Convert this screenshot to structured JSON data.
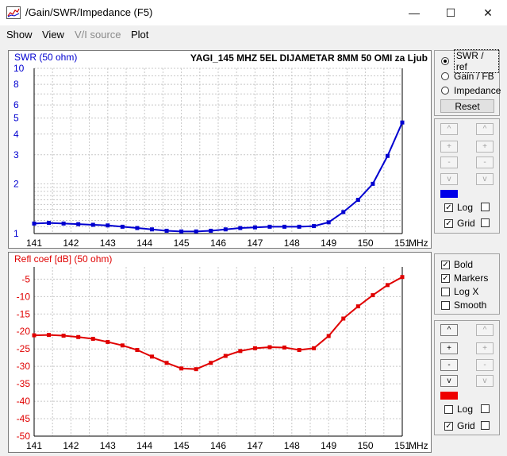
{
  "window": {
    "title": "/Gain/SWR/Impedance (F5)",
    "minimize": "—",
    "maximize": "☐",
    "close": "✕"
  },
  "menu": [
    {
      "label": "Show",
      "enabled": true
    },
    {
      "label": "View",
      "enabled": true
    },
    {
      "label": "V/I source",
      "enabled": false
    },
    {
      "label": "Plot",
      "enabled": true
    }
  ],
  "top_graph": {
    "title": "YAGI_145 MHZ 5EL DIJAMETAR 8MM 50 OMI za Ljub",
    "ylabel": "SWR (50 ohm)",
    "y_ticks": [
      {
        "v": 1,
        "label": "1"
      },
      {
        "v": 2,
        "label": "2"
      },
      {
        "v": 3,
        "label": "3"
      },
      {
        "v": 4,
        "label": "4"
      },
      {
        "v": 5,
        "label": "5"
      },
      {
        "v": 6,
        "label": "6"
      },
      {
        "v": 8,
        "label": "8"
      },
      {
        "v": 10,
        "label": "10"
      }
    ],
    "color": "#0000d0"
  },
  "bottom_graph": {
    "ylabel": "Refl coef [dB] (50 ohm)",
    "y_ticks": [
      "-5",
      "-10",
      "-15",
      "-20",
      "-25",
      "-30",
      "-35",
      "-40",
      "-45",
      "-50"
    ],
    "color": "#e00000"
  },
  "x_axis": {
    "ticks": [
      "141",
      "142",
      "143",
      "144",
      "145",
      "146",
      "147",
      "148",
      "149",
      "150",
      "151"
    ],
    "unit": "MHz"
  },
  "chart_data": [
    {
      "type": "line",
      "ylabel": "SWR (50 ohm)",
      "xlabel": "MHz",
      "ylim": [
        1,
        10
      ],
      "xlim": [
        141,
        151
      ],
      "log_scale_y": true,
      "grid": true,
      "series": [
        {
          "x": [
            141,
            141.4,
            141.8,
            142.2,
            142.6,
            143,
            143.4,
            143.8,
            144.2,
            144.6,
            145,
            145.4,
            145.8,
            146.2,
            146.6,
            147,
            147.4,
            147.8,
            148.2,
            148.6,
            149,
            149.4,
            149.8,
            150.2,
            150.6,
            151
          ],
          "y": [
            1.15,
            1.16,
            1.15,
            1.14,
            1.13,
            1.12,
            1.1,
            1.08,
            1.06,
            1.04,
            1.03,
            1.03,
            1.04,
            1.06,
            1.08,
            1.09,
            1.1,
            1.1,
            1.1,
            1.11,
            1.17,
            1.35,
            1.6,
            2.0,
            2.95,
            4.7
          ]
        }
      ]
    },
    {
      "type": "line",
      "ylabel": "Refl coef [dB] (50 ohm)",
      "xlabel": "MHz",
      "ylim": [
        -50,
        -1.5
      ],
      "xlim": [
        141,
        151
      ],
      "grid": true,
      "series": [
        {
          "x": [
            141,
            141.4,
            141.8,
            142.2,
            142.6,
            143,
            143.4,
            143.8,
            144.2,
            144.6,
            145,
            145.4,
            145.8,
            146.2,
            146.6,
            147,
            147.4,
            147.8,
            148.2,
            148.6,
            149,
            149.4,
            149.8,
            150.2,
            150.6,
            151
          ],
          "y": [
            -21.1,
            -21.0,
            -21.2,
            -21.6,
            -22.1,
            -23.0,
            -24.0,
            -25.3,
            -27.2,
            -29.0,
            -30.6,
            -30.8,
            -29.0,
            -27.0,
            -25.6,
            -24.8,
            -24.5,
            -24.6,
            -25.3,
            -24.8,
            -21.3,
            -16.3,
            -12.8,
            -9.6,
            -6.7,
            -4.4
          ]
        }
      ]
    }
  ],
  "controls_top": {
    "radios": [
      {
        "label": "SWR / ref",
        "checked": true
      },
      {
        "label": "Gain / FB",
        "checked": false
      },
      {
        "label": "Impedance",
        "checked": false
      }
    ],
    "reset_label": "Reset",
    "scale_buttons": [
      "^",
      "+",
      "-",
      "v"
    ],
    "swatch_color": "#0000e8",
    "log_label": "Log",
    "log_checked": true,
    "grid_label": "Grid",
    "grid_checked": true
  },
  "controls_mid": {
    "items": [
      {
        "label": "Bold",
        "checked": true
      },
      {
        "label": "Markers",
        "checked": true
      },
      {
        "label": "Log X",
        "checked": false
      },
      {
        "label": "Smooth",
        "checked": false
      }
    ]
  },
  "controls_bottom": {
    "scale_buttons": [
      "^",
      "+",
      "-",
      "v"
    ],
    "swatch_color": "#ee0000",
    "log_label": "Log",
    "log_checked": false,
    "grid_label": "Grid",
    "grid_checked": true
  }
}
